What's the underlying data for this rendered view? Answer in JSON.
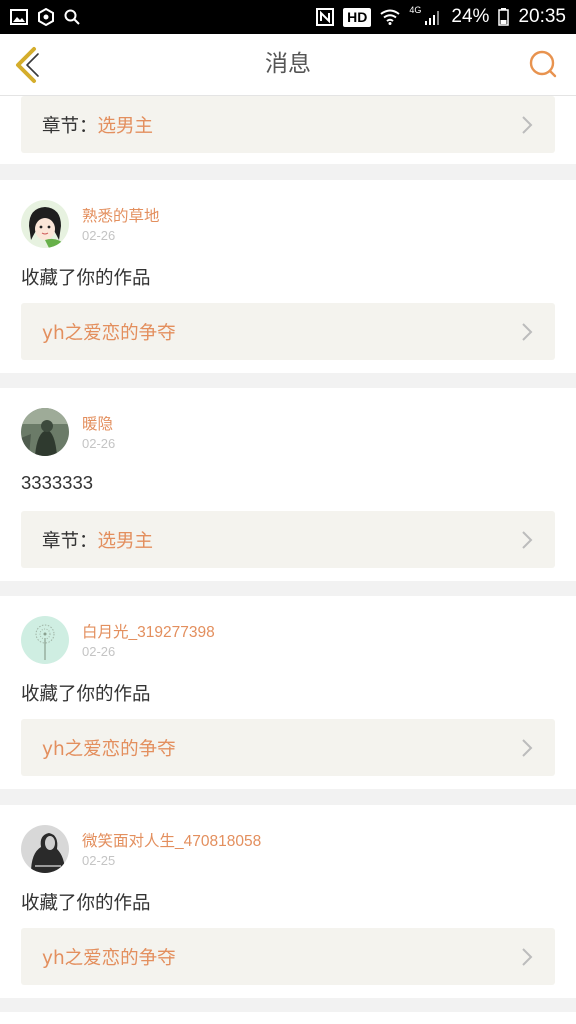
{
  "status_bar": {
    "hd": "HD",
    "network": "4G",
    "battery": "24%",
    "time": "20:35"
  },
  "header": {
    "title": "消息"
  },
  "top_item": {
    "label_prefix": "章节：",
    "label_value": "选男主"
  },
  "items": [
    {
      "username": "熟悉的草地",
      "date": "02-26",
      "message": "收藏了你的作品",
      "link": {
        "prefix": "",
        "value": "yh之爱恋的争夺"
      }
    },
    {
      "username": "暖隐",
      "date": "02-26",
      "message": "3333333",
      "link": {
        "prefix": "章节：",
        "value": "选男主"
      }
    },
    {
      "username": "白月光_319277398",
      "date": "02-26",
      "message": "收藏了你的作品",
      "link": {
        "prefix": "",
        "value": "yh之爱恋的争夺"
      }
    },
    {
      "username": "微笑面对人生_470818058",
      "date": "02-25",
      "message": "收藏了你的作品",
      "link": {
        "prefix": "",
        "value": "yh之爱恋的争夺"
      }
    }
  ],
  "colors": {
    "accent": "#e38f5e",
    "back_arrow": "#d4ad2c",
    "link_box_bg": "#f4f3ee",
    "page_bg": "#f2f2f2"
  }
}
